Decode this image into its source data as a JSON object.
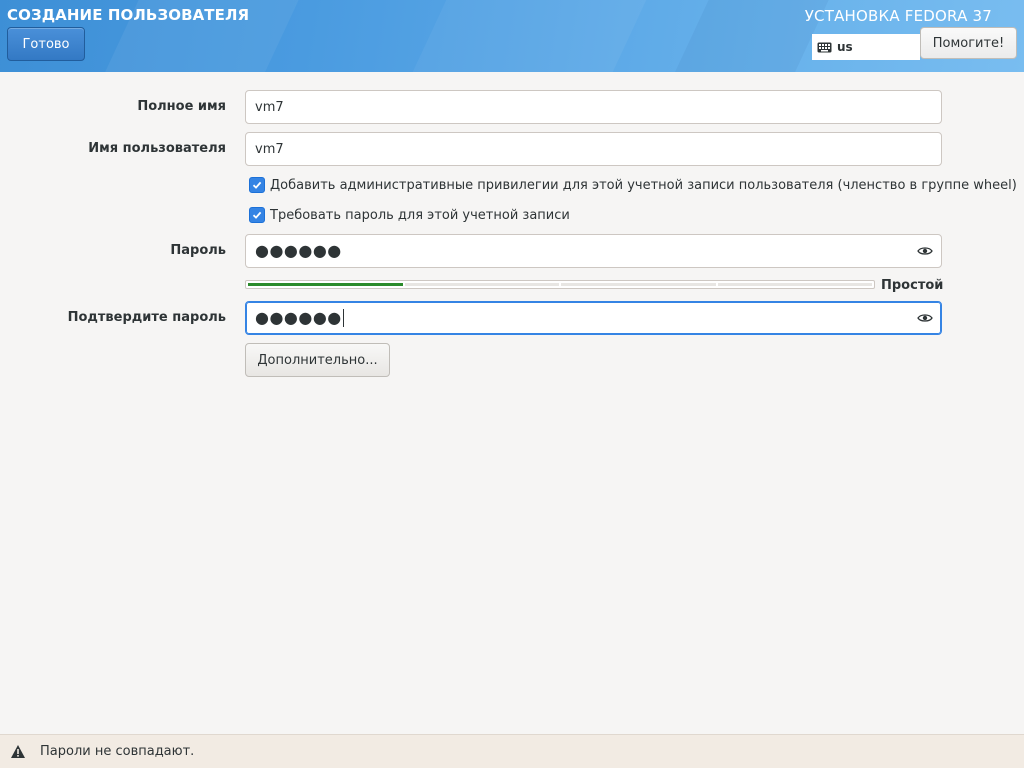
{
  "header": {
    "page_title": "СОЗДАНИЕ ПОЛЬЗОВАТЕЛЯ",
    "done_label": "Готово",
    "product_title": "УСТАНОВКА FEDORA 37",
    "keyboard_layout": "us",
    "help_label": "Помогите!"
  },
  "form": {
    "full_name_label": "Полное имя",
    "full_name_value": "vm7",
    "username_label": "Имя пользователя",
    "username_value": "vm7",
    "admin_checkbox": {
      "label": "Добавить административные привилегии для этой учетной записи пользователя (членство в группе wheel)",
      "checked": true
    },
    "require_password_checkbox": {
      "label": "Требовать пароль для этой учетной записи",
      "checked": true
    },
    "password_label": "Пароль",
    "password_masked": "●●●●●●",
    "strength": {
      "label": "Простой",
      "level": 0.25
    },
    "confirm_label": "Подтвердите пароль",
    "confirm_masked": "●●●●●●",
    "advanced_label": "Дополнительно..."
  },
  "status": {
    "message": "Пароли не совпадают.",
    "icon": "warning-icon"
  },
  "colors": {
    "header_blue": "#4a9be0",
    "accent": "#3584e4",
    "strength_fill": "#2b8a2b",
    "background": "#f6f5f4"
  }
}
